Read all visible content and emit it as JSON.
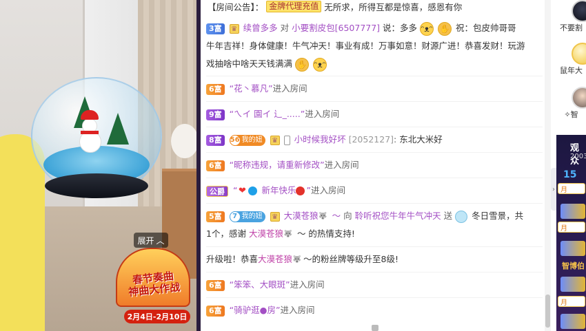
{
  "colors": {
    "accent_purple": "#a34fc4",
    "notice_tag_bg": "#fde36a",
    "level_orange": "#ee7820",
    "level_purple": "#7d35c7",
    "level_blue": "#3e6fd8",
    "promo_red": "#d4210f",
    "rail_panel": "#1c1740"
  },
  "video": {
    "expand_label": "展开",
    "expand_icon": "chevron-up-icon",
    "promo": {
      "title_line1": "春节奏曲",
      "title_line2": "神曲大作战",
      "date": "2月4日-2月10日"
    }
  },
  "notice": {
    "label": "【房间公告】：",
    "tag": "金牌代理充值",
    "text": "无所求，所得互都是惊喜，感恩有你"
  },
  "messages": [
    {
      "level": "3富",
      "user": "续曾多多",
      "mid": "对",
      "target": "小要割皮包[6507777]",
      "text_a": "说：多多",
      "text_b": "祝：包皮帅哥哥",
      "line2": "牛年吉祥！身体健康！牛气冲天！事业有成！万事如意！财源广进！恭喜发财！玩游",
      "line3": "戏抽啥中啥天天钱满满"
    },
    {
      "level": "6富",
      "user": "花丶慕凡",
      "enter": "进入房间"
    },
    {
      "level": "9富",
      "user": "ㄟイ 園イ 辶_.....",
      "enter": "进入房间"
    },
    {
      "level": "8富",
      "fan_num": "56",
      "fan_label": "我的妞",
      "user": "小时候我好坏",
      "rid": "[2052127]",
      "text": "东北大米好"
    },
    {
      "level": "6富",
      "user": "昵称违规，请重新修改",
      "enter": "进入房间"
    },
    {
      "level": "公爵",
      "user": "新年快乐",
      "enter": "进入房间"
    },
    {
      "level": "5富",
      "fan_num": "7",
      "fan_label": "我的妞",
      "user": "大漠苍狼",
      "tail": "～",
      "to": "向",
      "target": "聆听祝您牛年牛气冲天",
      "send": "送",
      "gift": "冬日雪景，共",
      "line2_a": "1个，感谢",
      "line2_user": "大漠苍狼",
      "line2_b": "～ 的热情支持!"
    },
    {
      "text_a": "升级啦！恭喜",
      "user": "大漠苍狼",
      "text_b": "～的粉丝牌等级升至8级!"
    },
    {
      "level": "6富",
      "user": "笨笨、大眼斑",
      "enter": "进入房间"
    },
    {
      "level": "6富",
      "user": "骑驴逛●房",
      "enter": "进入房间"
    }
  ],
  "rail": {
    "users": [
      {
        "name": "不要割",
        "avatar": "avatar-dark"
      },
      {
        "name": "鼠年大",
        "avatar": "avatar-gold"
      },
      {
        "name": "✧智",
        "avatar": "avatar-face"
      }
    ],
    "panel_title": "观众",
    "panel_count": "2003",
    "rank_first": "15",
    "month_badge": "月",
    "gold_text": "智博伯"
  }
}
